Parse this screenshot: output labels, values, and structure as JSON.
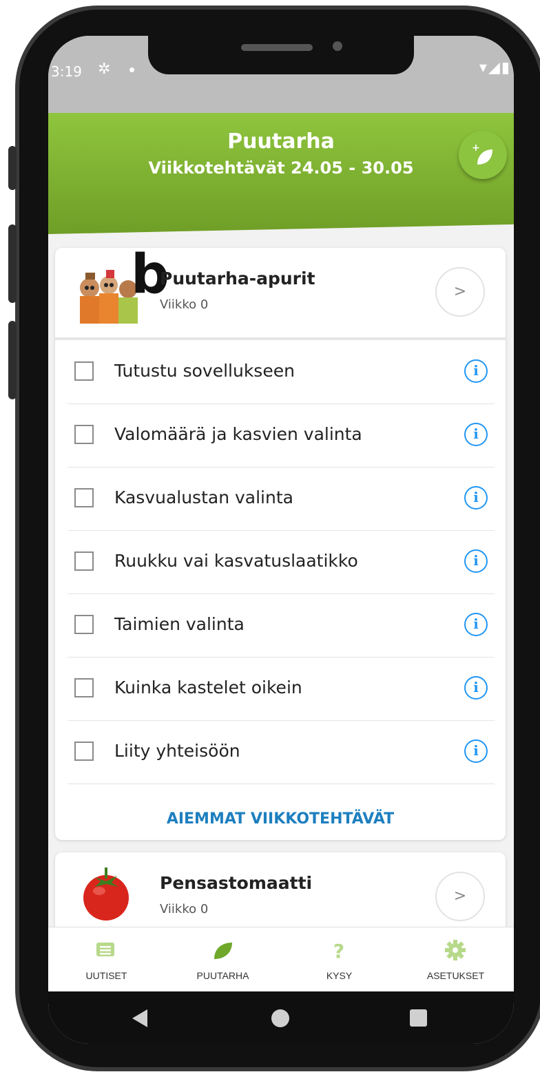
{
  "status": {
    "time": "3:19"
  },
  "header": {
    "title": "Puutarha",
    "subtitle": "Viikkotehtävät 24.05 - 30.05"
  },
  "annotation_letter": "b",
  "plants": [
    {
      "name": "Puutarha-apurit",
      "week": "Viikko 0"
    },
    {
      "name": "Pensastomaatti",
      "week": "Viikko 0"
    }
  ],
  "tasks": [
    {
      "label": "Tutustu sovellukseen",
      "checked": false
    },
    {
      "label": "Valomäärä ja kasvien valinta",
      "checked": false
    },
    {
      "label": "Kasvualustan valinta",
      "checked": false
    },
    {
      "label": "Ruukku vai kasvatuslaatikko",
      "checked": false
    },
    {
      "label": "Taimien valinta",
      "checked": false
    },
    {
      "label": "Kuinka kastelet oikein",
      "checked": false
    },
    {
      "label": "Liity yhteisöön",
      "checked": false
    }
  ],
  "previous_tasks_label": "AIEMMAT VIIKKOTEHTÄVÄT",
  "nav": [
    {
      "label": "UUTISET",
      "icon": "news-icon"
    },
    {
      "label": "PUUTARHA",
      "icon": "leaf-icon"
    },
    {
      "label": "KYSY",
      "icon": "question-icon"
    },
    {
      "label": "ASETUKSET",
      "icon": "gear-icon"
    }
  ],
  "colors": {
    "header_green": "#7fb232",
    "accent_blue": "#2196f3",
    "link_blue": "#1d7fbf",
    "nav_green": "#8cc43f"
  }
}
